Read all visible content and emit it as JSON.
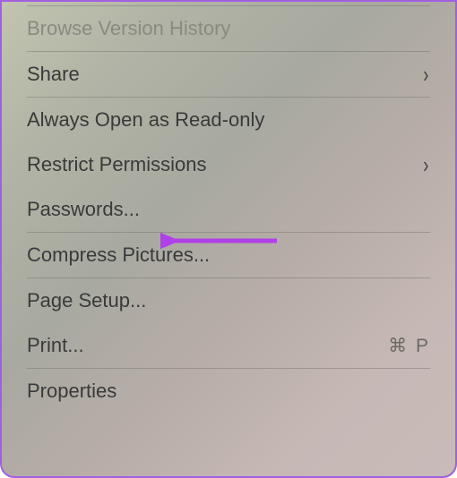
{
  "menu": {
    "browse_history": "Browse Version History",
    "share": "Share",
    "always_read_only": "Always Open as Read-only",
    "restrict_permissions": "Restrict Permissions",
    "passwords": "Passwords...",
    "compress_pictures": "Compress Pictures...",
    "page_setup": "Page Setup...",
    "print": "Print...",
    "print_shortcut": "⌘ P",
    "properties": "Properties"
  }
}
